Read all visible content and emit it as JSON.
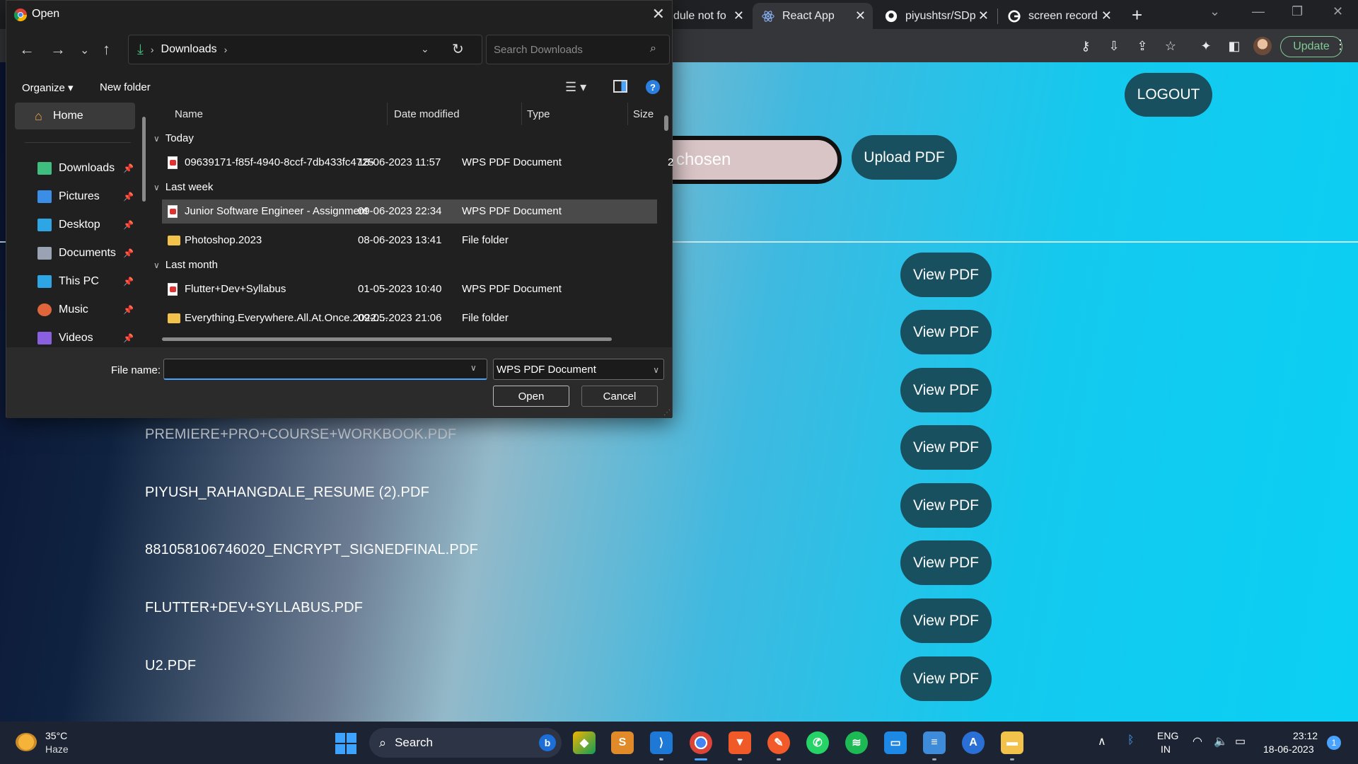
{
  "browser": {
    "tabs": [
      {
        "title": "dule not fo",
        "favicon": "chrome-icon"
      },
      {
        "title": "React App",
        "favicon": "react-icon",
        "active": true
      },
      {
        "title": "piyushtsr/SDp",
        "favicon": "github-icon"
      },
      {
        "title": "screen record",
        "favicon": "google-icon"
      }
    ],
    "update_label": "Update"
  },
  "page": {
    "logout_label": "LOGOUT",
    "file_chooser_text": "chosen",
    "upload_label": "Upload PDF",
    "view_label": "View PDF",
    "files": [
      "PREMIERE+PRO+COURSE+WORKBOOK.PDF",
      "PIYUSH_RAHANGDALE_RESUME (2).PDF",
      "881058106746020_ENCRYPT_SIGNEDFINAL.PDF",
      "FLUTTER+DEV+SYLLABUS.PDF",
      "U2.PDF"
    ]
  },
  "dialog": {
    "title": "Open",
    "address": {
      "location": "Downloads"
    },
    "search_placeholder": "Search Downloads",
    "organize_label": "Organize",
    "new_folder_label": "New folder",
    "nav": {
      "home": "Home",
      "items": [
        {
          "label": "Downloads",
          "icon": "download-icon",
          "color": "#3fbf7f"
        },
        {
          "label": "Pictures",
          "icon": "pictures-icon",
          "color": "#3a8ee6"
        },
        {
          "label": "Desktop",
          "icon": "desktop-icon",
          "color": "#2ea6e6"
        },
        {
          "label": "Documents",
          "icon": "documents-icon",
          "color": "#9aa3b3"
        },
        {
          "label": "This PC",
          "icon": "computer-icon",
          "color": "#2ea6e6"
        },
        {
          "label": "Music",
          "icon": "music-icon",
          "color": "#e0653a"
        },
        {
          "label": "Videos",
          "icon": "videos-icon",
          "color": "#8a5fe0"
        }
      ]
    },
    "columns": {
      "name": "Name",
      "date": "Date modified",
      "type": "Type",
      "size": "Size"
    },
    "groups": {
      "today": "Today",
      "last_week": "Last week",
      "last_month": "Last month"
    },
    "files": [
      {
        "name": "09639171-f85f-4940-8ccf-7db433fc4725",
        "date": "18-06-2023 11:57",
        "type": "WPS PDF Document",
        "size": "2",
        "kind": "pdf"
      },
      {
        "name": "Junior Software Engineer - Assignment",
        "date": "09-06-2023 22:34",
        "type": "WPS PDF Document",
        "size": "",
        "kind": "pdf"
      },
      {
        "name": "Photoshop.2023",
        "date": "08-06-2023 13:41",
        "type": "File folder",
        "size": "",
        "kind": "folder"
      },
      {
        "name": "Flutter+Dev+Syllabus",
        "date": "01-05-2023 10:40",
        "type": "WPS PDF Document",
        "size": "",
        "kind": "pdf"
      },
      {
        "name": "Everything.Everywhere.All.At.Once.2022....",
        "date": "09-05-2023 21:06",
        "type": "File folder",
        "size": "",
        "kind": "folder"
      }
    ],
    "file_name_label": "File name:",
    "file_name_value": "",
    "file_type": "WPS PDF Document",
    "open_label": "Open",
    "cancel_label": "Cancel"
  },
  "taskbar": {
    "temperature": "35°C",
    "weather": "Haze",
    "search_label": "Search",
    "lang_top": "ENG",
    "lang_bottom": "IN",
    "time": "23:12",
    "date": "18-06-2023",
    "notification_count": "1"
  }
}
